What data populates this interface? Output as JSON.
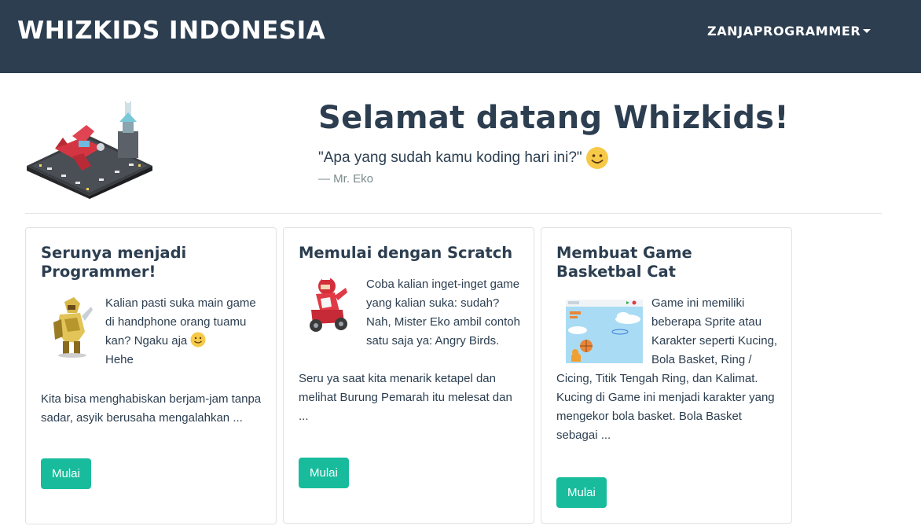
{
  "navbar": {
    "brand": "WHIZKIDS INDONESIA",
    "user_menu": "ZANJAPROGRAMMER",
    "background": "#2c3e50"
  },
  "hero": {
    "title": "Selamat datang Whizkids!",
    "quote": "\"Apa yang sudah kamu koding hari ini?\"",
    "author": "— Mr. Eko",
    "image_icon": "pixel-airport-icon"
  },
  "cards": [
    {
      "title": "Serunya menjadi Programmer!",
      "text_lines": [
        "Kalian pasti suka main game di handphone orang tuamu kan? Ngaku aja",
        "Hehe"
      ],
      "paragraph2": "Kita bisa menghabiskan berjam-jam tanpa sadar, asyik berusaha mengalahkan ...",
      "button": "Mulai",
      "thumb_icon": "pixel-knight-icon"
    },
    {
      "title": "Memulai dengan Scratch",
      "paragraph1": "Coba kalian inget-inget game yang kalian suka: sudah? Nah, Mister Eko ambil contoh satu saja ya: Angry Birds.",
      "paragraph2": "Seru ya saat kita menarik ketapel dan melihat Burung Pemarah itu melesat dan ...",
      "button": "Mulai",
      "thumb_icon": "pixel-red-rider-icon"
    },
    {
      "title": "Membuat Game Basketbal Cat",
      "paragraph1": "Game ini memiliki beberapa Sprite atau Karakter seperti Kucing, Bola Basket, Ring / Cicing, Titik Tengah Ring, dan Kalimat. Kucing di Game ini menjadi karakter yang mengekor bola basket. Bola Basket sebagai ...",
      "button": "Mulai",
      "thumb_icon": "scratch-basketball-screenshot-icon"
    }
  ],
  "colors": {
    "accent": "#18bc9c",
    "text": "#2c3e50",
    "muted": "#7b8a8b"
  }
}
